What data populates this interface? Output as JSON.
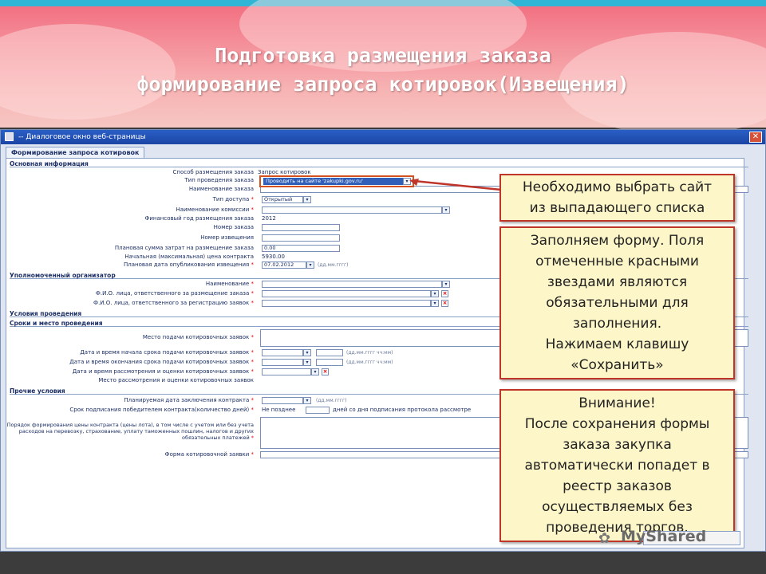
{
  "slide": {
    "title_line1": "Подготовка размещения заказа",
    "title_line2": "формирование запроса котировок(Извещения)"
  },
  "window": {
    "title": "-- Диалоговое окно веб-страницы",
    "close": "✕",
    "tab": "Формирование запроса котировок"
  },
  "sections": {
    "main": "Основная информация",
    "org": "Уполномоченный организатор",
    "conditions": "Условия проведения",
    "terms": "Сроки и место проведения",
    "other": "Прочие условия"
  },
  "main": {
    "method_label": "Способ размещения заказа",
    "method_value": "Запрос котировок",
    "type_label": "Тип проведения заказа",
    "type_value": "Проводить на сайте 'zakupki.gov.ru'",
    "name_label": "Наименование заказа",
    "access_label": "Тип доступа",
    "access_value": "Открытый",
    "commission_label": "Наименование комиссии",
    "year_label": "Финансовый год размещения заказа",
    "year_value": "2012",
    "order_no_label": "Номер заказа",
    "notice_no_label": "Номер извещения",
    "planned_sum_label": "Плановая сумма затрат на размещение заказа",
    "planned_sum_value": "0.00",
    "start_price_label": "Начальная (максимальная) цена контракта",
    "start_price_value": "5930.00",
    "pub_date_label": "Плановая дата опубликования извещения",
    "pub_date_value": "07.02.2012",
    "pub_date_hint": "(дд.мм.гггг)"
  },
  "org": {
    "name_label": "Наименование",
    "resp_placement_label": "Ф.И.О. лица, ответственного за размещение заказа",
    "resp_register_label": "Ф.И.О. лица, ответственного за регистрацию заявок"
  },
  "terms": {
    "place_label": "Место подачи котировочных заявок",
    "start_label": "Дата и время начала срока подачи котировочных заявок",
    "end_label": "Дата и время окончания срока подачи котировочных заявок",
    "review_label": "Дата и время рассмотрения и оценки котировочных заявок",
    "review_place_label": "Место рассмотрения и оценки котировочных заявок",
    "datetime_hint": "(дд.мм.гггг чч:мм)"
  },
  "other": {
    "contract_date_label": "Планируемая дата заключения контракта",
    "date_hint": "(дд.мм.гггг)",
    "sign_term_label": "Срок подписания победителем контракта(количество дней)",
    "not_later": "Не позднее",
    "days_after": "дней со дня подписания протокола рассмотре",
    "price_order_label": "Порядок формирования цены контракта (цены лота), в том числе с учетом или без учета расходов на перевозку, страхование, уплату таможенных пошлин, налогов и других обязательных платежей",
    "quote_form_label": "Форма котировочной заявки"
  },
  "callouts": {
    "c1": "Необходимо выбрать сайт\nиз выпадающего списка",
    "c2": "Заполняем форму. Поля\nотмеченные красными\nзвездами являются\nобязательными для\nзаполнения.\nНажимаем клавишу\n«Сохранить»",
    "c3": "Внимание!\nПосле сохранения формы\nзаказа закупка\nавтоматически попадет в\nреестр заказов\nосуществляемых без\nпроведения торгов."
  },
  "watermark": "MyShared",
  "colors": {
    "callout_bg": "#fdf6c8",
    "callout_border": "#c0352a",
    "highlight": "#d4511f",
    "titlebar": "#2a5fc6"
  }
}
